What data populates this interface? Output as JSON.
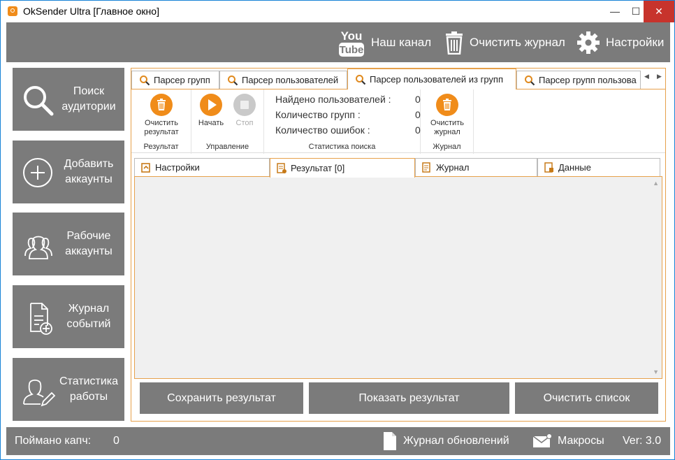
{
  "window": {
    "title": "OkSender Ultra [Главное окно]",
    "minimize": "—",
    "maximize": "☐",
    "close": "✕"
  },
  "header": {
    "youtube_icon_text_top": "You",
    "youtube_icon_text_bottom": "Tube",
    "channel_label": "Наш канал",
    "clear_log_label": "Очистить журнал",
    "settings_label": "Настройки"
  },
  "sidebar": {
    "items": [
      {
        "icon": "search-icon",
        "label": "Поиск аудитории"
      },
      {
        "icon": "add-circle-icon",
        "label": "Добавить аккаунты"
      },
      {
        "icon": "users-icon",
        "label": "Рабочие аккаунты"
      },
      {
        "icon": "document-add-icon",
        "label": "Журнал событий"
      },
      {
        "icon": "user-edit-icon",
        "label": "Статистика работы"
      }
    ]
  },
  "main": {
    "tabs": [
      {
        "label": "Парсер групп"
      },
      {
        "label": "Парсер пользователей"
      },
      {
        "label": "Парсер пользователей из групп",
        "active": true
      },
      {
        "label": "Парсер групп пользова"
      }
    ],
    "ribbon": {
      "result_group": {
        "button_label_1": "Очистить",
        "button_label_2": "результат",
        "group_label": "Результат"
      },
      "control_group": {
        "start_label": "Начать",
        "stop_label": "Стоп",
        "group_label": "Управление"
      },
      "stats_group": {
        "rows": [
          {
            "label": "Найдено пользователей :",
            "value": "0"
          },
          {
            "label": "Количество групп :",
            "value": "0"
          },
          {
            "label": "Количество ошибок :",
            "value": "0"
          }
        ],
        "group_label": "Статистика поиска"
      },
      "log_group": {
        "button_label_1": "Очистить",
        "button_label_2": "журнал",
        "group_label": "Журнал"
      }
    },
    "inner_tabs": [
      {
        "label": "Настройки"
      },
      {
        "label": "Результат [0]",
        "active": true
      },
      {
        "label": "Журнал"
      },
      {
        "label": "Данные"
      }
    ],
    "buttons": {
      "save": "Сохранить результат",
      "show": "Показать результат",
      "clear": "Очистить список"
    }
  },
  "statusbar": {
    "captcha_label": "Поймано капч:",
    "captcha_value": "0",
    "updates_label": "Журнал обновлений",
    "macros_label": "Макросы",
    "version": "Ver: 3.0"
  },
  "colors": {
    "accent": "#f08c1a",
    "panel_gray": "#7b7b7b",
    "border_orange": "#e7a14b",
    "close_red": "#c7332c"
  }
}
